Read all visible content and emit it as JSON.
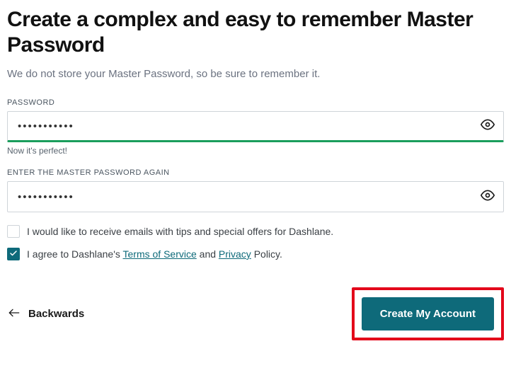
{
  "title": "Create a complex and easy to remember Master Password",
  "subtitle": "We do not store your Master Password, so be sure to remember it.",
  "password": {
    "label": "PASSWORD",
    "value": "•••••••••••",
    "strength_msg": "Now it's perfect!"
  },
  "confirm": {
    "label": "ENTER THE MASTER PASSWORD AGAIN",
    "value": "•••••••••••"
  },
  "checkboxes": {
    "marketing": {
      "checked": false,
      "label": "I would like to receive emails with tips and special offers for Dashlane."
    },
    "terms": {
      "checked": true,
      "prefix": "I agree to Dashlane's ",
      "tos": "Terms of Service",
      "middle": " and ",
      "privacy": "Privacy",
      "suffix": " Policy."
    }
  },
  "footer": {
    "back": "Backwards",
    "cta": "Create My Account"
  }
}
